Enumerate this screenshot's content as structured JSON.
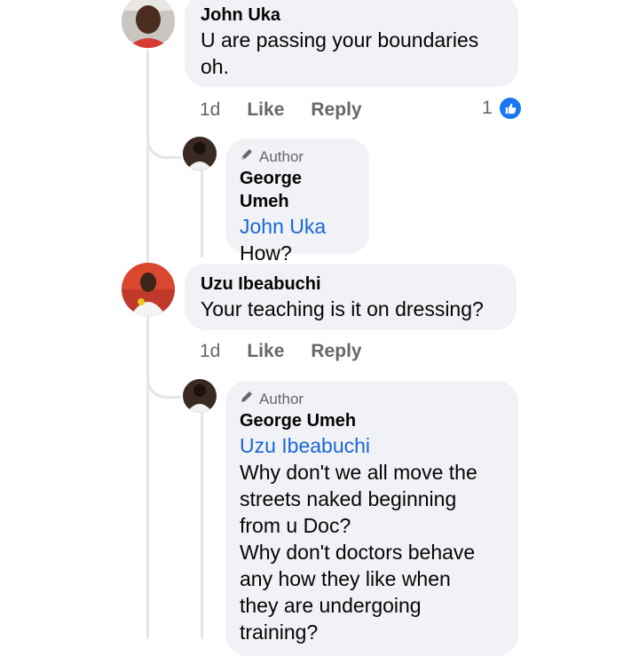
{
  "comments": [
    {
      "author": "John Uka",
      "text_lines": [
        "U are passing your boundaries",
        "oh."
      ],
      "time": "1d",
      "like_label": "Like",
      "reply_label": "Reply",
      "reaction_count": "1",
      "reply": {
        "badge": "Author",
        "author": "George Umeh",
        "mention": "John Uka",
        "text_lines": [
          "How?"
        ]
      }
    },
    {
      "author": "Uzu Ibeabuchi",
      "text_lines": [
        "Your teaching is it on dressing?"
      ],
      "time": "1d",
      "like_label": "Like",
      "reply_label": "Reply",
      "reply": {
        "badge": "Author",
        "author": "George Umeh",
        "mention": "Uzu Ibeabuchi",
        "text_lines": [
          "Why don't we all move the",
          "streets naked beginning",
          "from u Doc?",
          "Why don't doctors behave",
          "any how they like when",
          "they are undergoing",
          "training?"
        ]
      }
    }
  ],
  "colors": {
    "bubble": "#f0f2f5",
    "mention": "#1b66d8",
    "meta": "#65676b",
    "like_badge": "#1877f2"
  },
  "icons": {
    "author_badge": "pencil-icon",
    "reaction": "thumbs-up-icon"
  }
}
